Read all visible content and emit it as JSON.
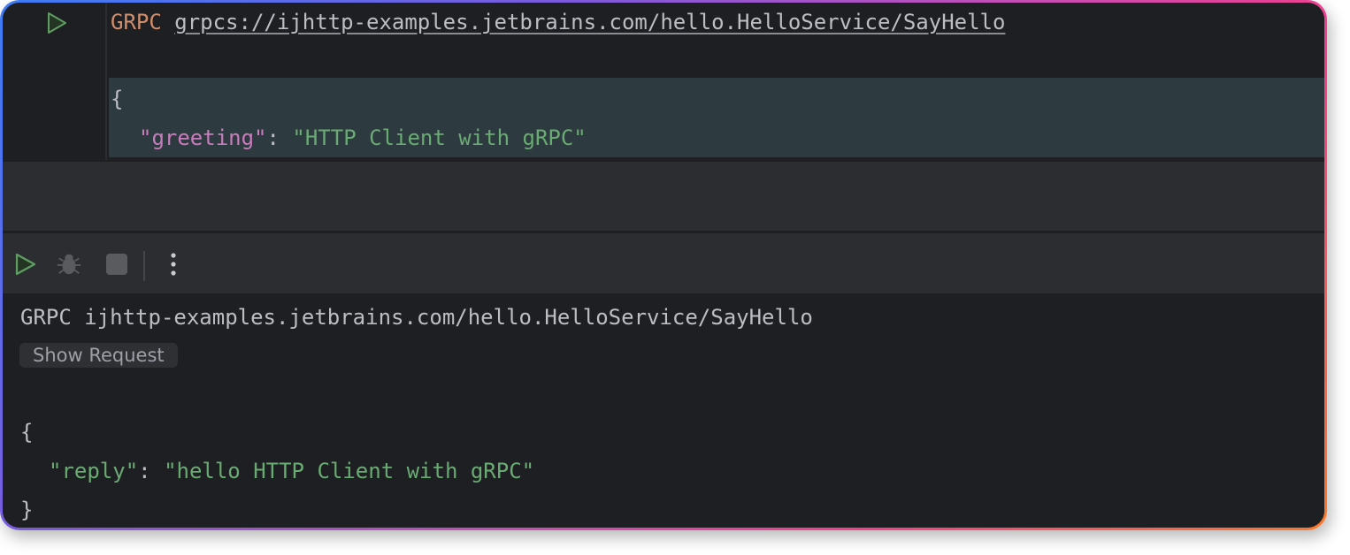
{
  "colors": {
    "border_gradient": [
      "#3d7cf5",
      "#7a5bdc",
      "#c64fb6",
      "#f43f8a",
      "#fb7a2a"
    ],
    "editor_bg": "#1e1f22",
    "panel_bg": "#2b2d30",
    "highlight_bg": "#2d3a3f",
    "keyword": "#cf8e6d",
    "json_key": "#c77dbb",
    "json_string": "#6aab73",
    "text": "#bcbec4",
    "run_green": "#5f9e62"
  },
  "editor": {
    "method": "GRPC",
    "url": "grpcs://ijhttp-examples.jetbrains.com/hello.HelloService/SayHello",
    "body": {
      "open_brace": "{",
      "key": "\"greeting\"",
      "colon": ": ",
      "value": "\"HTTP Client with gRPC\""
    },
    "run_icon": "run-gutter-icon"
  },
  "toolbar": {
    "buttons": [
      {
        "name": "run",
        "icon": "play-icon"
      },
      {
        "name": "debug",
        "icon": "bug-icon"
      },
      {
        "name": "stop",
        "icon": "stop-icon"
      },
      {
        "name": "more",
        "icon": "more-vertical-icon"
      }
    ]
  },
  "output": {
    "title": "GRPC ijhttp-examples.jetbrains.com/hello.HelloService/SayHello",
    "show_request_label": "Show Request",
    "response": {
      "open_brace": "{",
      "key": "\"reply\"",
      "colon": ": ",
      "value": "\"hello HTTP Client with gRPC\"",
      "close_brace": "}"
    }
  }
}
